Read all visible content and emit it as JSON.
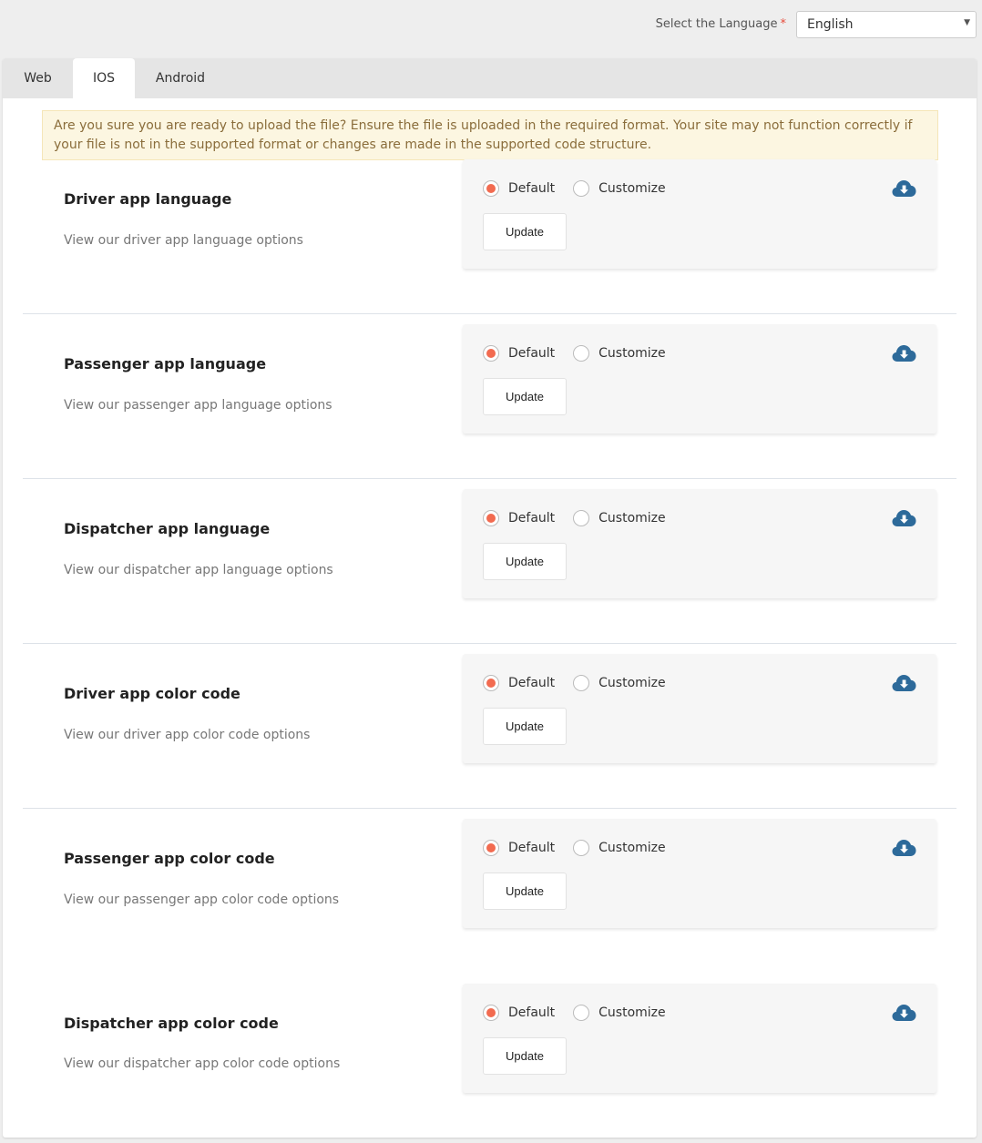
{
  "header": {
    "language_label": "Select the Language",
    "required_mark": "*",
    "language_selected": "English"
  },
  "tabs": [
    {
      "label": "Web",
      "active": false
    },
    {
      "label": "IOS",
      "active": true
    },
    {
      "label": "Android",
      "active": false
    }
  ],
  "notice": {
    "text": "Are you sure you are ready to upload the file? Ensure the file is uploaded in the required format. Your site may not function correctly if your file is not in the supported format or changes are made in the supported code structure."
  },
  "colors": {
    "radio_selected": "#f26b50",
    "cloud_icon": "#2d6a9a",
    "notice_bg": "#fcf6e1",
    "notice_text": "#8a6d3b"
  },
  "rows": [
    {
      "title": "Driver app language",
      "description": "View our driver app language options",
      "default_label": "Default",
      "customize_label": "Customize",
      "selected": "Default",
      "button_label": "Update",
      "icon": "cloud-download-icon"
    },
    {
      "title": "Passenger app language",
      "description": "View our passenger app language options",
      "default_label": "Default",
      "customize_label": "Customize",
      "selected": "Default",
      "button_label": "Update",
      "icon": "cloud-download-icon"
    },
    {
      "title": "Dispatcher app language",
      "description": "View our dispatcher app language options",
      "default_label": "Default",
      "customize_label": "Customize",
      "selected": "Default",
      "button_label": "Update",
      "icon": "cloud-download-icon"
    },
    {
      "title": "Driver app color code",
      "description": "View our driver app color code options",
      "default_label": "Default",
      "customize_label": "Customize",
      "selected": "Default",
      "button_label": "Update",
      "icon": "cloud-download-icon"
    },
    {
      "title": "Passenger app color code",
      "description": "View our passenger app color code options",
      "default_label": "Default",
      "customize_label": "Customize",
      "selected": "Default",
      "button_label": "Update",
      "icon": "cloud-download-icon"
    },
    {
      "title": "Dispatcher app color code",
      "description": "View our dispatcher app color code options",
      "default_label": "Default",
      "customize_label": "Customize",
      "selected": "Default",
      "button_label": "Update",
      "icon": "cloud-download-icon"
    }
  ]
}
